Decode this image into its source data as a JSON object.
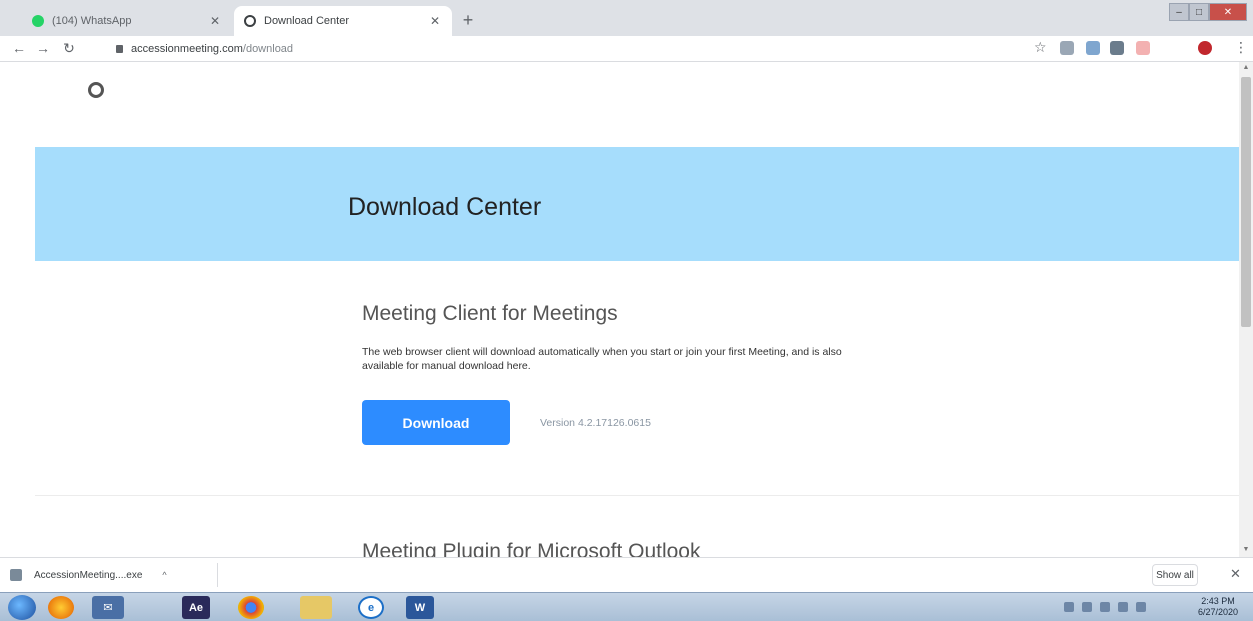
{
  "browser": {
    "tabs": [
      {
        "title": "(104) WhatsApp",
        "active": false
      },
      {
        "title": "Download Center",
        "active": true
      }
    ],
    "new_tab_label": "+",
    "url": {
      "host": "accessionmeeting.com",
      "path": "/download"
    }
  },
  "page": {
    "banner_title": "Download Center",
    "section1": {
      "title": "Meeting Client for Meetings",
      "description": "The web browser client will download automatically when you start or join your first Meeting, and is also available for manual download here.",
      "button_label": "Download",
      "version": "Version 4.2.17126.0615"
    },
    "section2": {
      "title": "Meeting Plugin for Microsoft Outlook"
    }
  },
  "download_shelf": {
    "file_name": "AccessionMeeting....exe",
    "show_all_label": "Show all"
  },
  "taskbar": {
    "apps": [
      "windows-explorer",
      "firefox",
      "outlook",
      "after-effects",
      "chrome",
      "file-explorer",
      "internet-explorer",
      "word"
    ],
    "clock_time": "2:43 PM",
    "clock_date": "6/27/2020"
  },
  "colors": {
    "banner": "#a6ddfc",
    "download_button": "#2d8cff",
    "tab_strip": "#dee1e6"
  }
}
